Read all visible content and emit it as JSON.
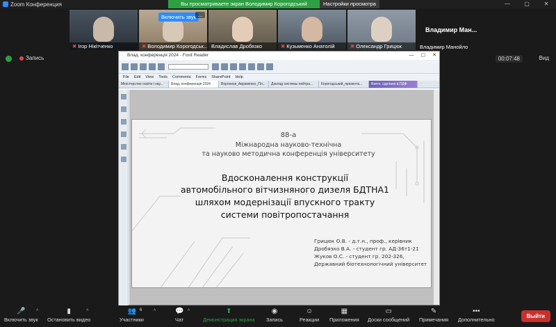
{
  "window": {
    "title": "Zoom Конференция",
    "controls": [
      "—",
      "▢",
      "✕"
    ]
  },
  "share_banner": {
    "message": "Вы просматриваете экран Володимир Корогодський",
    "options": "Настройки просмотра"
  },
  "participants": [
    {
      "name": "Ігор Нікітченко",
      "muted": true
    },
    {
      "name": "Володимир Корогодськ...",
      "muted": true,
      "unmute_label": "Включить звук"
    },
    {
      "name": "Владислав Дробязко",
      "muted": false
    },
    {
      "name": "Кузьменко Анатолій",
      "muted": true
    },
    {
      "name": "Олександр Грицюк",
      "muted": true
    },
    {
      "name": "Владимир Манойло",
      "big_label": "Владимир  Ман..."
    }
  ],
  "status": {
    "recording": "Запись",
    "timer": "00:07:48",
    "view": "Вид"
  },
  "foxit": {
    "title": "Влад. конференція 2024 - Foxit Reader",
    "menu": [
      "File",
      "Edit",
      "View",
      "Tools",
      "Comments",
      "Forms",
      "SharePoint",
      "Help"
    ],
    "tabs": [
      "Міністерство освіти і нау...",
      "Влад. конференція 2024",
      "Воронков_Авраменко_Пл...",
      "Доклад системы нейтра...",
      "Корогодський_презента...",
      "Взято. сделано в.ПДФ"
    ]
  },
  "slide": {
    "conf_line1": "88-а",
    "conf_line2": "Міжнародна науково-технічна",
    "conf_line3": "та науково методична конференція університету",
    "title_lines": [
      "Вдосконалення конструкції",
      "автомобільного вітчизняного дизеля БДТНА1",
      "шляхом модернізації впускного тракту",
      "системи повітропостачання"
    ],
    "authors": [
      "Грицюк О.В. - д.т.н., проф., керівник",
      "Дробязко В.А. - студент гр. АД-36т1-21",
      "Жуков О.С. - студент гр. 202-326,",
      "Державний біотехнологічний університет"
    ]
  },
  "toolbar": {
    "unmute": "Включить звук",
    "start_video": "Остановить видео",
    "participants": "Участники",
    "participants_count": "6",
    "chat": "Чат",
    "share": "Демонстрация экрана",
    "record": "Запись",
    "reactions": "Реакции",
    "apps": "Приложения",
    "whiteboards": "Доски сообщений",
    "notes": "Примечания",
    "more": "Дополнительно",
    "leave": "Выйти"
  },
  "colors": {
    "accent_green": "#2ea043",
    "zoom_blue": "#2d8cff",
    "leave_red": "#c9302c"
  }
}
